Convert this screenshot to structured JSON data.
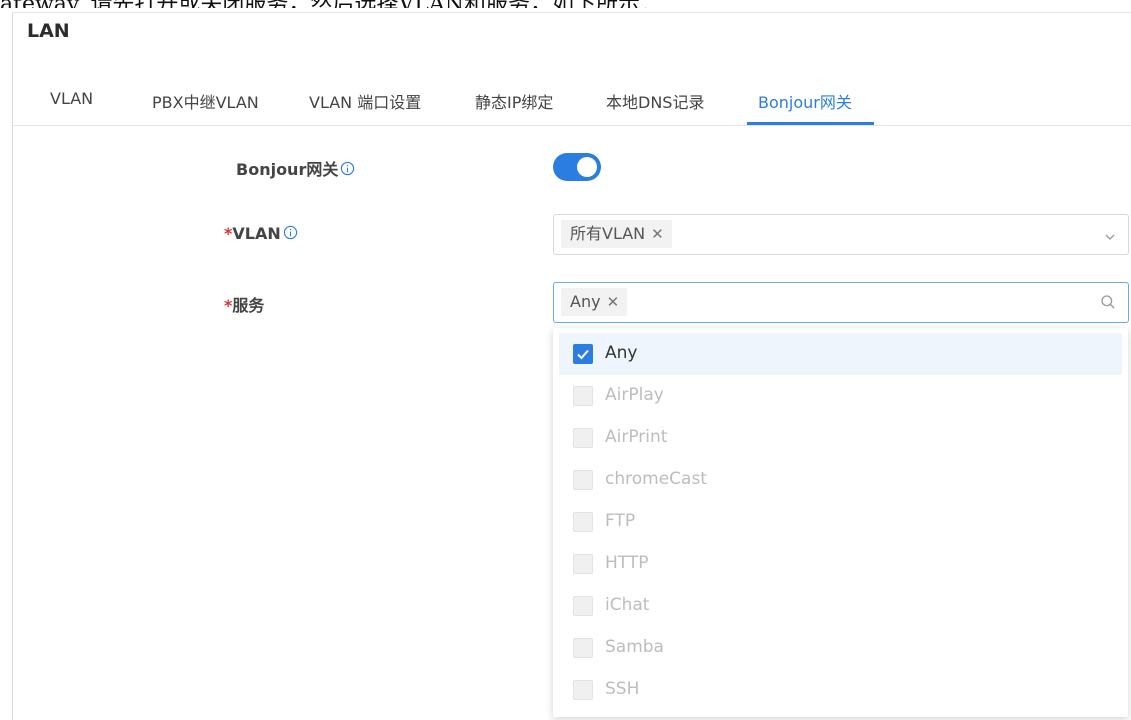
{
  "caption": "ateway, 请先打开或关闭服务，然后选择VLAN和服务，如下所示：",
  "section_title": "LAN",
  "tabs": [
    {
      "label": "VLAN"
    },
    {
      "label": "PBX中继VLAN"
    },
    {
      "label": "VLAN 端口设置"
    },
    {
      "label": "静态IP绑定"
    },
    {
      "label": "本地DNS记录"
    },
    {
      "label": "Bonjour网关",
      "active": true
    }
  ],
  "form": {
    "bonjour_label": "Bonjour网关",
    "bonjour_enabled": true,
    "vlan_label": "VLAN",
    "vlan_chip": "所有VLAN",
    "service_label": "服务",
    "service_chip": "Any",
    "required_mark": "*"
  },
  "service_options": [
    {
      "label": "Any",
      "checked": true
    },
    {
      "label": "AirPlay",
      "checked": false
    },
    {
      "label": "AirPrint",
      "checked": false
    },
    {
      "label": "chromeCast",
      "checked": false
    },
    {
      "label": "FTP",
      "checked": false
    },
    {
      "label": "HTTP",
      "checked": false
    },
    {
      "label": "iChat",
      "checked": false
    },
    {
      "label": "Samba",
      "checked": false
    },
    {
      "label": "SSH",
      "checked": false
    }
  ],
  "colors": {
    "accent": "#2b7de1",
    "required": "#e03030",
    "disabled_text": "#bdbdbd"
  },
  "icons": {
    "info": "info-circle-icon",
    "chevron": "chevron-down-icon",
    "search": "search-icon",
    "check": "check-icon",
    "remove": "close-icon"
  }
}
